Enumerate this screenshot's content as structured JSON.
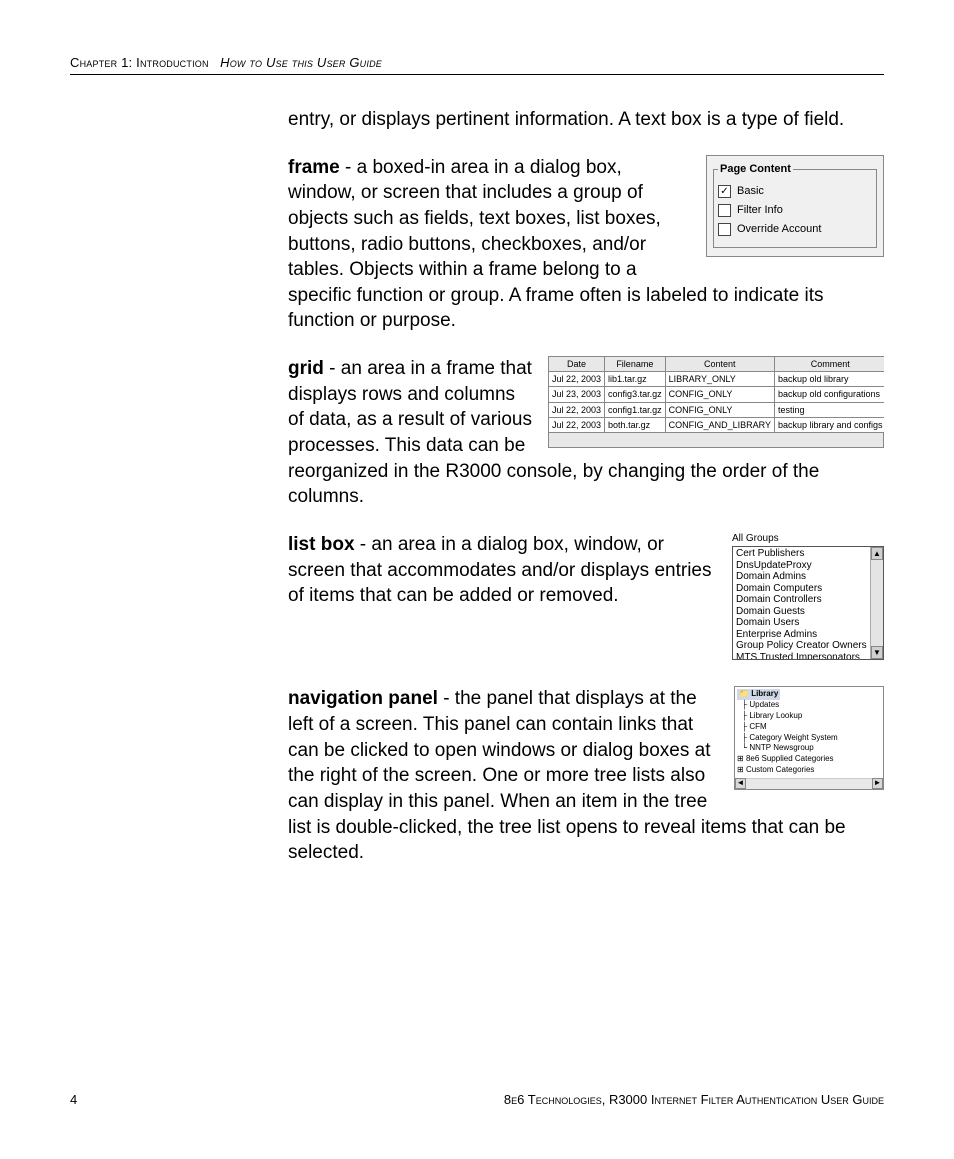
{
  "header": {
    "chapter": "Chapter 1: Introduction",
    "section": "How to Use this User Guide"
  },
  "intro_tail": "entry, or displays pertinent information. A text box is a type of field.",
  "frame": {
    "term": "frame",
    "def_a": " - a boxed-in area in a dialog box, window, or screen that includes a group of objects such as fields, text boxes, list boxes, buttons, radio buttons, check",
    "def_b": "boxes, and/or tables. Objects within a frame belong to a specific function or group. A frame often is labeled to indicate its function or purpose.",
    "fig": {
      "legend": "Page Content",
      "items": [
        "Basic",
        "Filter Info",
        "Override Account"
      ],
      "checked": [
        true,
        false,
        false
      ]
    }
  },
  "grid": {
    "term": "grid",
    "def_a": " - an area in a frame that displays rows and columns of ",
    "def_b": "data, as a result of various processes. This data can be reorganized in the R3000 console, by changing the order of the columns.",
    "headers": [
      "Date",
      "Filename",
      "Content",
      "Comment"
    ],
    "rows": [
      [
        "Jul 22, 2003",
        "lib1.tar.gz",
        "LIBRARY_ONLY",
        "backup old library"
      ],
      [
        "Jul 23, 2003",
        "config3.tar.gz",
        "CONFIG_ONLY",
        "backup old configurations"
      ],
      [
        "Jul 22, 2003",
        "config1.tar.gz",
        "CONFIG_ONLY",
        "testing"
      ],
      [
        "Jul 22, 2003",
        "both.tar.gz",
        "CONFIG_AND_LIBRARY",
        "backup library and configs"
      ]
    ]
  },
  "listbox": {
    "term": "list box",
    "def": " - an area in a dialog box, window, or screen that accommodates and/or displays entries of items that can be added or removed.",
    "label": "All Groups",
    "items": [
      "Cert Publishers",
      "DnsUpdateProxy",
      "Domain Admins",
      "Domain Computers",
      "Domain Controllers",
      "Domain Guests",
      "Domain Users",
      "Enterprise Admins",
      "Group Policy Creator Owners",
      "MTS Trusted Impersonators"
    ]
  },
  "navpanel": {
    "term": "navigation panel",
    "def": " - the panel that displays at the left of a screen. This panel can contain links that can be clicked to open windows or dialog boxes at the right of the screen. One or more tree lists also can display in this panel. When an item in the tree list is double-clicked, the tree list opens to reveal items that can be selected.",
    "tree": {
      "root": "Library",
      "children": [
        "Updates",
        "Library Lookup",
        "CFM",
        "Category Weight System",
        "NNTP Newsgroup"
      ],
      "collapsed": [
        "8e6 Supplied Categories",
        "Custom Categories"
      ]
    }
  },
  "footer": {
    "page": "4",
    "title": "8e6 Technologies, R3000 Internet Filter Authentication User Guide"
  }
}
